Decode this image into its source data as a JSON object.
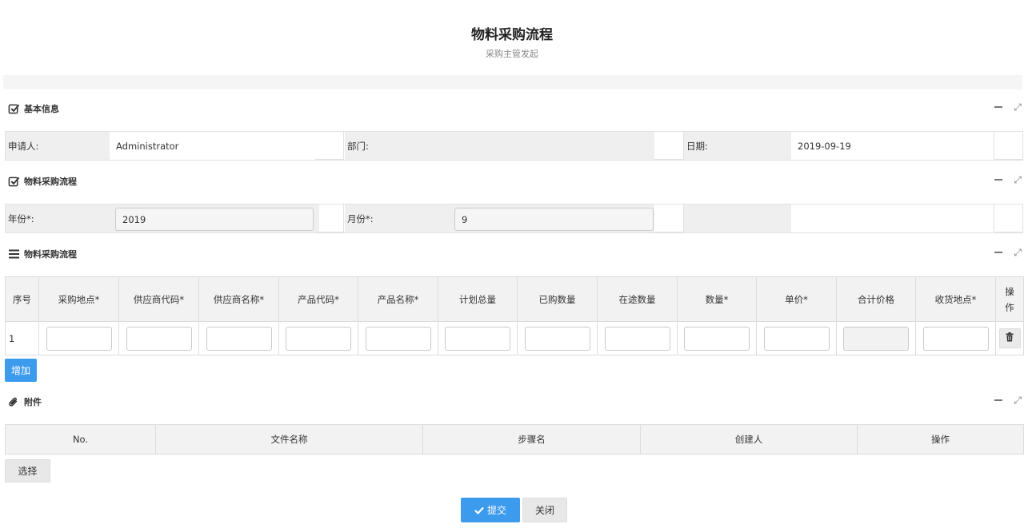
{
  "header": {
    "title": "物料采购流程",
    "subtitle": "采购主管发起"
  },
  "sections": {
    "basic": {
      "title": "基本信息"
    },
    "process": {
      "title": "物料采购流程"
    },
    "detail": {
      "title": "物料采购流程"
    },
    "attach": {
      "title": "附件"
    }
  },
  "basic": {
    "applicant_label": "申请人:",
    "applicant_value": "Administrator",
    "dept_label": "部门:",
    "dept_value": "",
    "date_label": "日期:",
    "date_value": "2019-09-19"
  },
  "process": {
    "year_label": "年份*:",
    "year_value": "2019",
    "month_label": "月份*:",
    "month_value": "9"
  },
  "detail_table": {
    "headers": [
      "序号",
      "采购地点*",
      "供应商代码*",
      "供应商名称*",
      "产品代码*",
      "产品名称*",
      "计划总量",
      "已购数量",
      "在途数量",
      "数量*",
      "单价*",
      "合计价格",
      "收货地点*",
      "操作"
    ],
    "rows": [
      {
        "index": "1"
      }
    ],
    "add_label": "增加"
  },
  "attach_table": {
    "headers": [
      "No.",
      "文件名称",
      "步骤名",
      "创建人",
      "操作"
    ],
    "select_label": "选择"
  },
  "footer": {
    "submit_label": "提交",
    "close_label": "关闭"
  },
  "colors": {
    "primary": "#3d9bee",
    "label_bg": "#efefef",
    "header_bg": "#f2f2f2"
  }
}
